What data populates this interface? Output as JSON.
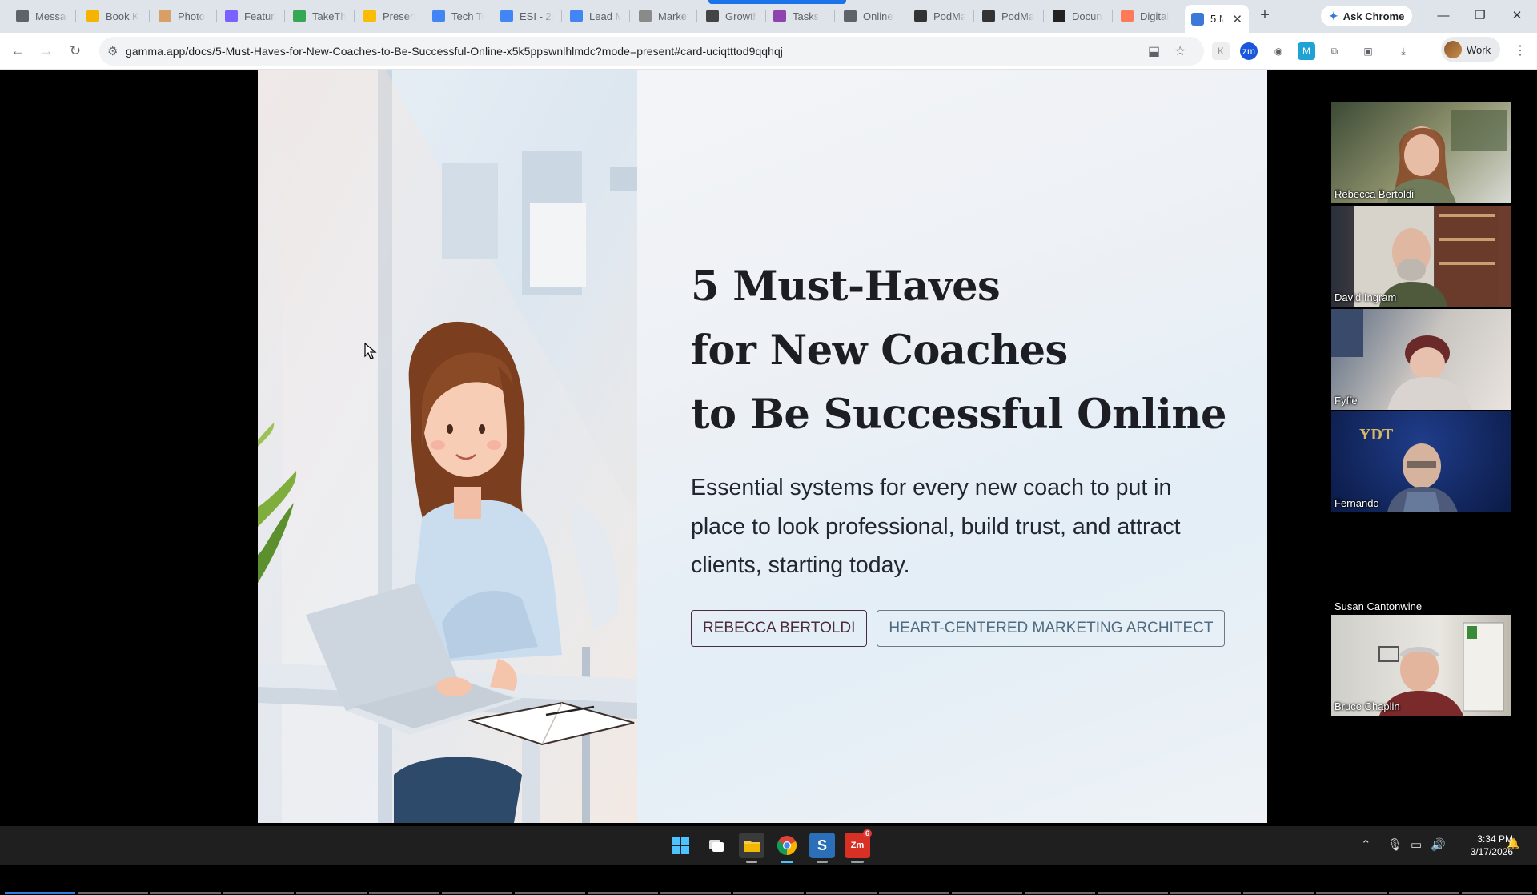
{
  "browser": {
    "tabs": [
      {
        "label": "Messag",
        "icon": "messenger-icon",
        "color": "#5f6368"
      },
      {
        "label": "Book K",
        "icon": "b-icon",
        "color": "#f4b400"
      },
      {
        "label": "Photo",
        "icon": "person-icon",
        "color": "#d9a066"
      },
      {
        "label": "Feature",
        "icon": "feature-icon",
        "color": "#7b61ff"
      },
      {
        "label": "TakeTh",
        "icon": "drive-icon",
        "color": "#34a853"
      },
      {
        "label": "Present",
        "icon": "drive-icon",
        "color": "#fbbc04"
      },
      {
        "label": "Tech Tc",
        "icon": "docs-icon",
        "color": "#4285f4"
      },
      {
        "label": "ESI - 20",
        "icon": "docs-icon",
        "color": "#4285f4"
      },
      {
        "label": "Lead M",
        "icon": "docs-icon",
        "color": "#4285f4"
      },
      {
        "label": "Market",
        "icon": "page-icon",
        "color": "#8a8a8a"
      },
      {
        "label": "Growth",
        "icon": "rb-icon",
        "color": "#444444"
      },
      {
        "label": "Tasks",
        "icon": "tasks-icon",
        "color": "#8e44ad"
      },
      {
        "label": "Online",
        "icon": "globe-icon",
        "color": "#5f6368"
      },
      {
        "label": "PodMa",
        "icon": "podmatch-icon",
        "color": "#333333"
      },
      {
        "label": "PodMa",
        "icon": "podmatch-icon",
        "color": "#333333"
      },
      {
        "label": "Docun",
        "icon": "docu-icon",
        "color": "#222222"
      },
      {
        "label": "Digital",
        "icon": "hubspot-icon",
        "color": "#ff7a59"
      },
      {
        "label": "5 M",
        "icon": "gamma-icon",
        "color": "#3c78d8",
        "active": true
      }
    ],
    "new_tab": "+",
    "ask_chrome": "Ask Chrome",
    "url": "gamma.app/docs/5-Must-Haves-for-New-Coaches-to-Be-Successful-Online-x5k5ppswnlhlmdc?mode=present#card-uciqtttod9qqhqj",
    "profile_label": "Work"
  },
  "slide": {
    "title_lines": [
      "5 Must-Haves",
      "for New Coaches",
      "to Be Successful Online"
    ],
    "subtitle": "Essential systems for every new coach to put in place to look professional, build trust, and attract clients, starting today.",
    "tag_name": "REBECCA BERTOLDI",
    "tag_role": "HEART-CENTERED MARKETING ARCHITECT",
    "progress_segments_done": 1,
    "progress_segments_total": 21
  },
  "meeting": {
    "participants": [
      {
        "name": "Rebecca Bertoldi",
        "video": true
      },
      {
        "name": "David Ingram",
        "video": true
      },
      {
        "name": "Fyffe",
        "video": true
      },
      {
        "name": "Fernando",
        "video": true
      },
      {
        "name": "Susan Cantonwine",
        "video": false
      },
      {
        "name": "Bruce Chaplin",
        "video": true
      }
    ]
  },
  "taskbar": {
    "time": "3:34 PM",
    "date": "3/17/2026",
    "zoom_badge": "6"
  }
}
